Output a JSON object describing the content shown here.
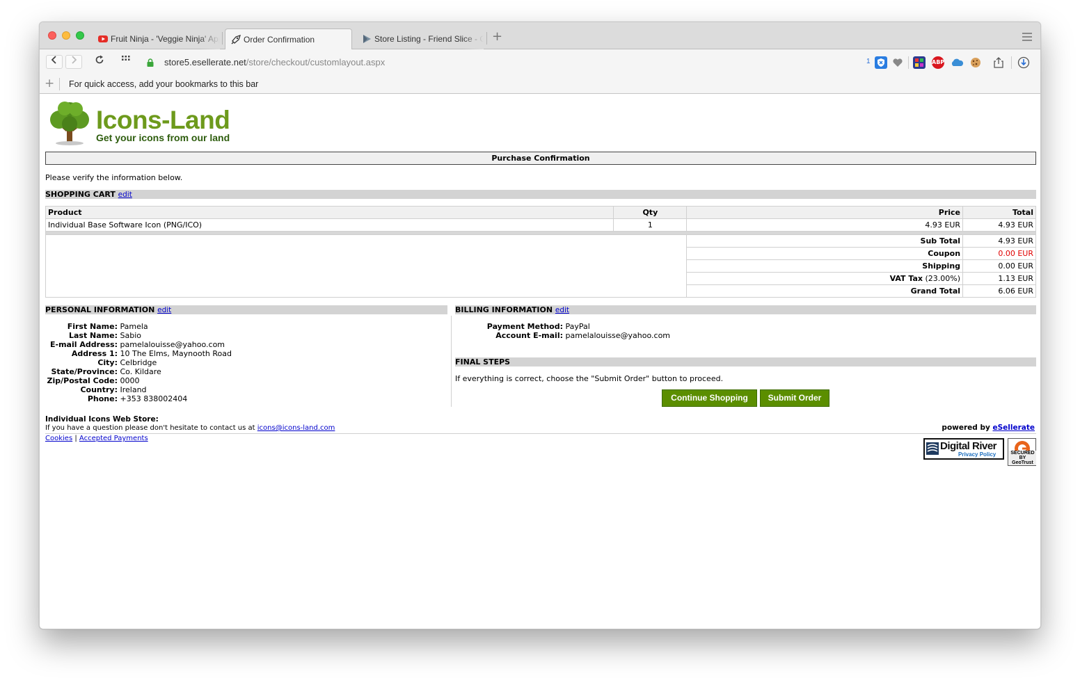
{
  "browser": {
    "tabs": [
      {
        "title": "Fruit Ninja - 'Veggie Ninja' App",
        "icon": "youtube-icon"
      },
      {
        "title": "Order Confirmation",
        "icon": "rocket-icon"
      },
      {
        "title": "Store Listing - Friend Slice - Goo",
        "icon": "play-store-icon"
      }
    ],
    "url_host": "store5.esellerate.net",
    "url_path": "/store/checkout/customlayout.aspx",
    "ext_badge_count": "1",
    "bookmarks_hint": "For quick access, add your bookmarks to this bar",
    "abp_label": "ABP"
  },
  "store": {
    "logo_title": "Icons-Land",
    "logo_tagline": "Get your icons from our land",
    "banner": "Purchase Confirmation",
    "verify_text": "Please verify the information below."
  },
  "cart": {
    "heading": "SHOPPING CART",
    "edit": "edit",
    "columns": {
      "product": "Product",
      "qty": "Qty",
      "price": "Price",
      "total": "Total"
    },
    "items": [
      {
        "product": "Individual Base Software Icon (PNG/ICO)",
        "qty": "1",
        "price": "4.93 EUR",
        "total": "4.93 EUR"
      }
    ],
    "summary": [
      {
        "label": "Sub Total",
        "value": "4.93 EUR"
      },
      {
        "label": "Coupon",
        "value": "0.00 EUR"
      },
      {
        "label": "Shipping",
        "value": "0.00 EUR"
      },
      {
        "label": "VAT Tax",
        "label_extra": " (23.00%)",
        "value": "1.13 EUR"
      },
      {
        "label": "Grand Total",
        "value": "6.06 EUR"
      }
    ]
  },
  "personal": {
    "heading": "PERSONAL INFORMATION",
    "edit": "edit",
    "fields": [
      {
        "label": "First Name:",
        "value": "Pamela"
      },
      {
        "label": "Last Name:",
        "value": "Sabio"
      },
      {
        "label": "E-mail Address:",
        "value": "pamelalouisse@yahoo.com"
      },
      {
        "label": "Address 1:",
        "value": "10 The Elms, Maynooth Road"
      },
      {
        "label": "City:",
        "value": "Celbridge"
      },
      {
        "label": "State/Province:",
        "value": "Co. Kildare"
      },
      {
        "label": "Zip/Postal Code:",
        "value": "0000"
      },
      {
        "label": "Country:",
        "value": "Ireland"
      },
      {
        "label": "Phone:",
        "value": "+353 838002404"
      }
    ]
  },
  "billing": {
    "heading": "BILLING INFORMATION",
    "edit": "edit",
    "fields": [
      {
        "label": "Payment Method:",
        "value": "PayPal"
      },
      {
        "label": "Account E-mail:",
        "value": "pamelalouisse@yahoo.com"
      }
    ]
  },
  "final": {
    "heading": "FINAL STEPS",
    "text": "If everything is correct, choose the \"Submit Order\" button to proceed.",
    "continue_button": "Continue Shopping",
    "submit_button": "Submit Order"
  },
  "footer": {
    "store_name": "Individual Icons Web Store:",
    "contact_text": "If you have a question please don't hesitate to contact us at ",
    "contact_email": "icons@icons-land.com",
    "powered_by": "powered by ",
    "powered_link": "eSellerate",
    "cookies": "Cookies",
    "separator": "|",
    "accepted_payments": "Accepted Payments",
    "dr_title": "Digital River",
    "dr_privacy": "Privacy Policy",
    "geotrust_text": "SECURED BY GeoTrust"
  },
  "colors": {
    "brand_green": "#6d9a1c",
    "button_green": "#5b8e00",
    "coupon_red": "#e00000",
    "link_blue": "#0000cc"
  }
}
